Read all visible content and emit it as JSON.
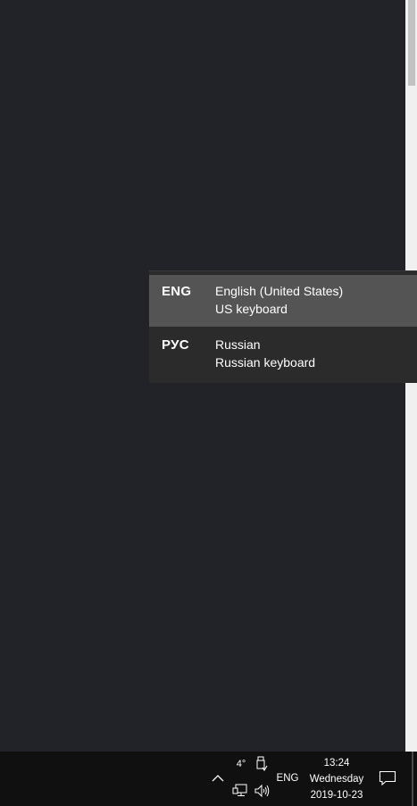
{
  "language_flyout": {
    "items": [
      {
        "code": "ENG",
        "name": "English (United States)",
        "keyboard": "US keyboard",
        "selected": true
      },
      {
        "code": "РУС",
        "name": "Russian",
        "keyboard": "Russian keyboard",
        "selected": false
      }
    ]
  },
  "taskbar": {
    "weather_temp": "4°",
    "input_language": "ENG",
    "clock": {
      "time": "13:24",
      "day": "Wednesday",
      "date": "2019-10-23"
    },
    "icons": {
      "chevron": "chevron-up-icon",
      "usb": "usb-safely-remove-icon",
      "network": "network-icon",
      "volume": "volume-icon",
      "notifications": "notifications-icon"
    }
  },
  "colors": {
    "desktop_background": "#222328",
    "flyout_background": "#2b2b2b",
    "flyout_selected": "#545454",
    "taskbar_background": "#101010",
    "text": "#ffffff"
  }
}
